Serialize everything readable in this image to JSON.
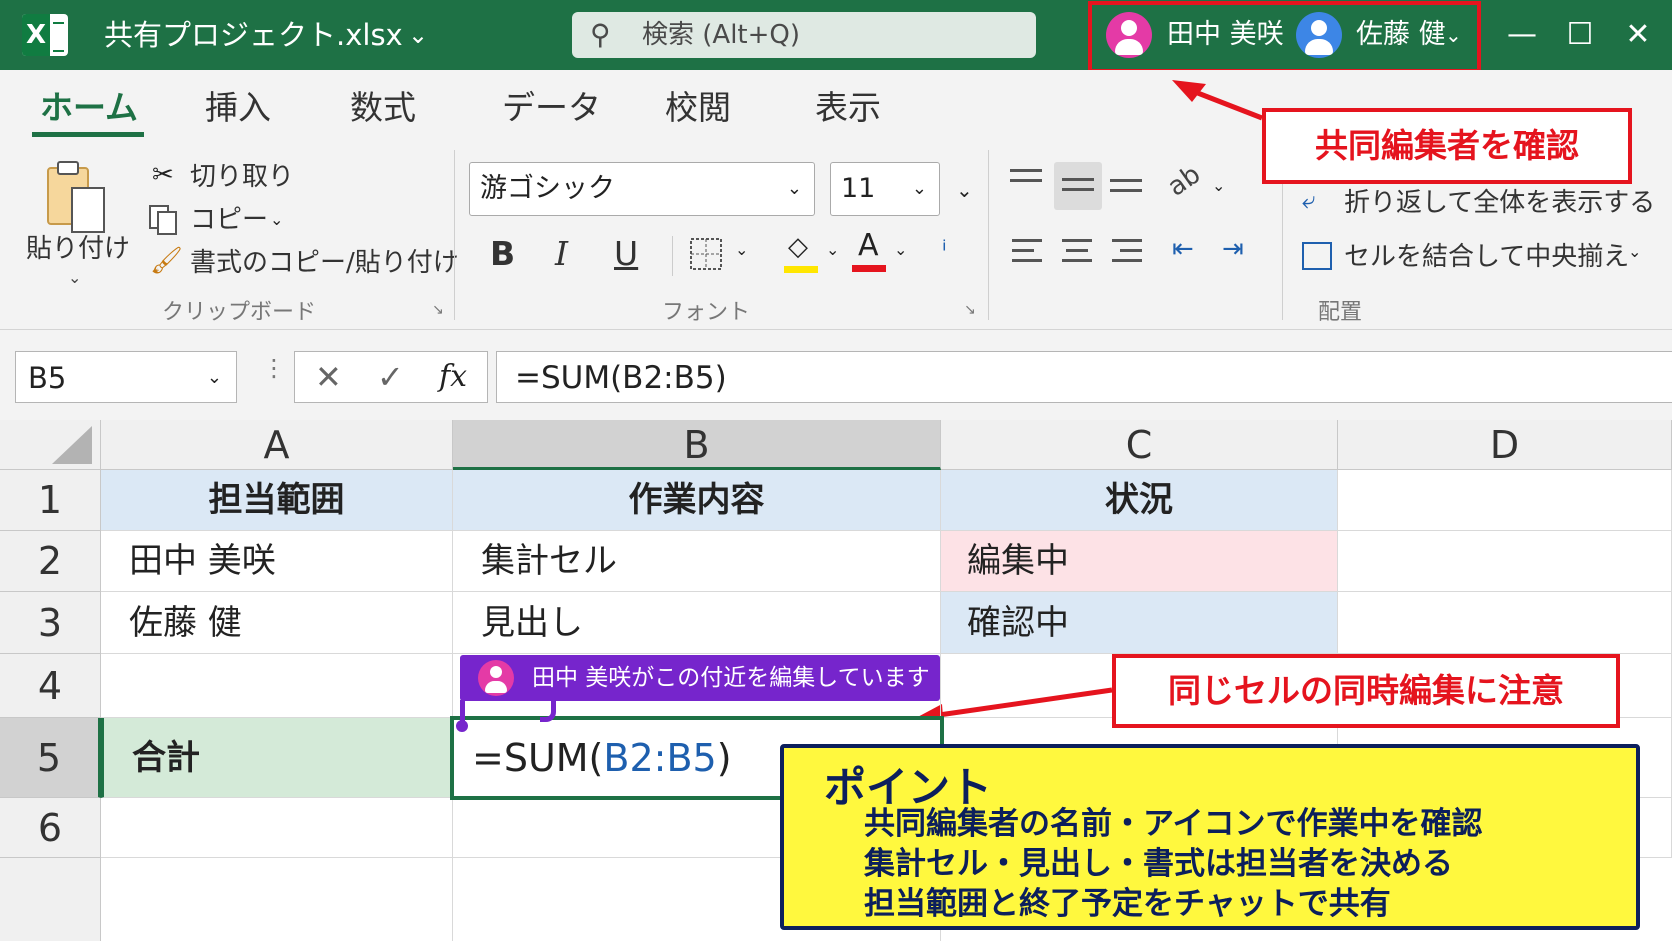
{
  "title_bar": {
    "app_icon": "X",
    "doc_title": "共有プロジェクト.xlsx",
    "search_placeholder": "検索 (Alt+Q)",
    "collaborators": [
      {
        "name": "田中 美咲",
        "color": "#e43aa6"
      },
      {
        "name": "佐藤 健",
        "color": "#3d86e6"
      }
    ],
    "window_buttons": [
      "minimize-icon",
      "maximize-icon",
      "close-icon"
    ]
  },
  "ribbon": {
    "tabs": [
      "ホーム",
      "挿入",
      "数式",
      "データ",
      "校閲",
      "表示"
    ],
    "active_tab": "ホーム",
    "clipboard": {
      "paste": "貼り付け",
      "cut": "切り取り",
      "copy": "コピー",
      "format_painter": "書式のコピー/貼り付け",
      "group_label": "クリップボード"
    },
    "font": {
      "font_name": "游ゴシック",
      "font_size": "11",
      "bold": "B",
      "italic": "I",
      "underline": "U",
      "group_label": "フォント",
      "fill_color": "#ffe600",
      "font_color": "#e5141e"
    },
    "alignment": {
      "wrap_text": "折り返して全体を表示する",
      "merge_center": "セルを結合して中央揃え",
      "group_label": "配置"
    }
  },
  "formula_bar": {
    "name_box": "B5",
    "formula": "=SUM(B2:B5)"
  },
  "sheet": {
    "columns": [
      "A",
      "B",
      "C",
      "D"
    ],
    "rows": [
      "1",
      "2",
      "3",
      "4",
      "5",
      "6"
    ],
    "header": [
      "担当範囲",
      "作業内容",
      "状況"
    ],
    "row2": [
      "田中 美咲",
      "集計セル",
      "編集中"
    ],
    "row3": [
      "佐藤 健",
      "見出し",
      "確認中"
    ],
    "row5_label": "合計",
    "active_cell": {
      "prefix": "=SUM(",
      "range": "B2:B5",
      "suffix": ")"
    }
  },
  "presence_flag": "田中 美咲がこの付近を編集しています",
  "callouts": {
    "collaborators": "共同編集者を確認",
    "same_cell": "同じセルの同時編集に注意"
  },
  "point_box": {
    "title": "ポイント",
    "lines": [
      "共同編集者の名前・アイコンで作業中を確認",
      "集計セル・見出し・書式は担当者を決める",
      "担当範囲と終了予定をチャットで共有"
    ]
  },
  "colors": {
    "title_bar": "#1e7145",
    "header_fill": "#dbe8f5",
    "editing_fill": "#fde2e6",
    "checking_fill": "#dbe8f5",
    "total_fill": "#d4ead8",
    "callout_red": "#e5141e",
    "point_yellow": "#fff83e",
    "presence_purple": "#7625cc"
  }
}
